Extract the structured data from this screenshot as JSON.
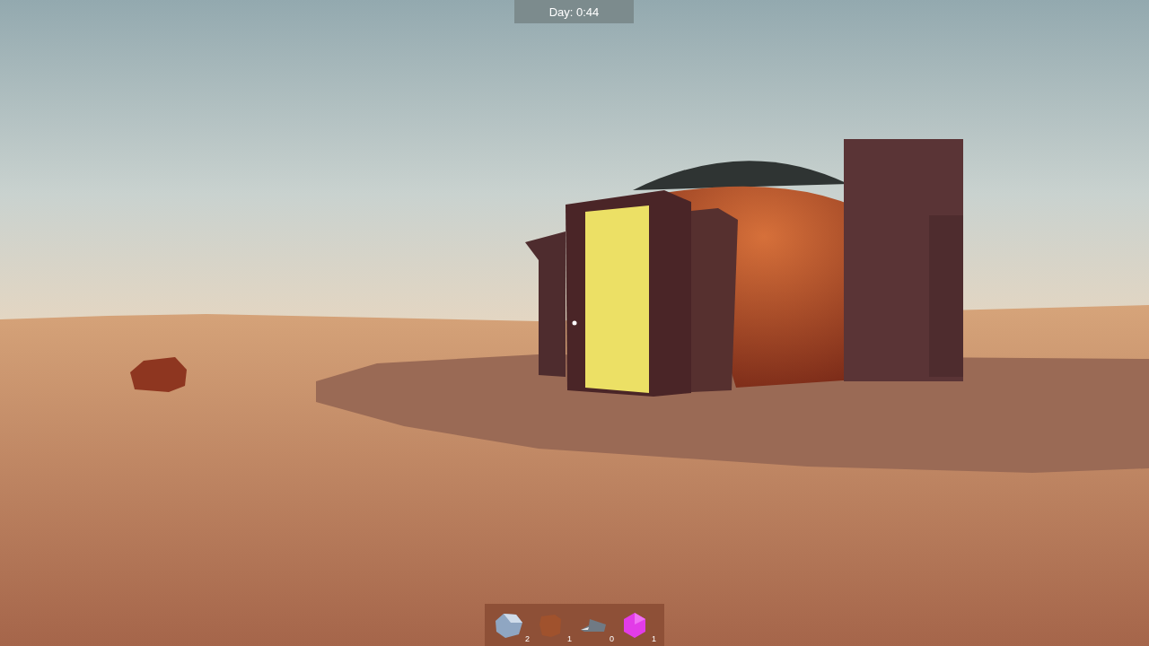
{
  "hud": {
    "day_timer": "Day: 0:44"
  },
  "inventory": [
    {
      "kind": "crystal",
      "count": "2"
    },
    {
      "kind": "ore",
      "count": "1"
    },
    {
      "kind": "scrap",
      "count": "0"
    },
    {
      "kind": "gem",
      "count": "1"
    }
  ]
}
